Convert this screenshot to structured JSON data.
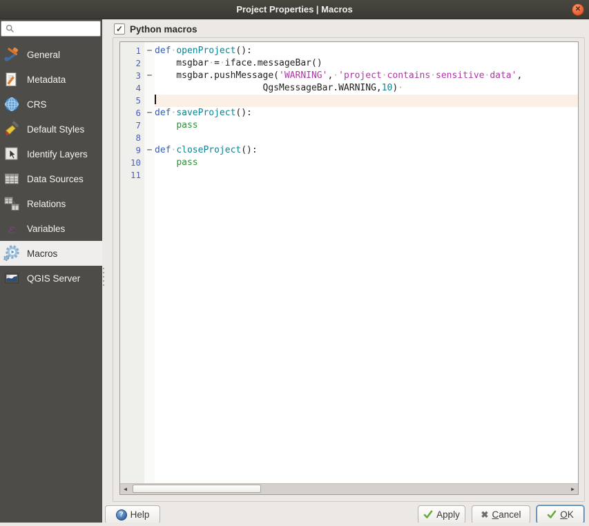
{
  "titlebar": {
    "title": "Project Properties | Macros",
    "close_icon": "✕"
  },
  "sidebar": {
    "search_placeholder": "",
    "items": [
      {
        "id": "general",
        "label": "General",
        "selected": false
      },
      {
        "id": "metadata",
        "label": "Metadata",
        "selected": false
      },
      {
        "id": "crs",
        "label": "CRS",
        "selected": false
      },
      {
        "id": "default-styles",
        "label": "Default Styles",
        "selected": false
      },
      {
        "id": "identify-layers",
        "label": "Identify Layers",
        "selected": false
      },
      {
        "id": "data-sources",
        "label": "Data Sources",
        "selected": false
      },
      {
        "id": "relations",
        "label": "Relations",
        "selected": false
      },
      {
        "id": "variables",
        "label": "Variables",
        "selected": false
      },
      {
        "id": "macros",
        "label": "Macros",
        "selected": true
      },
      {
        "id": "qgis-server",
        "label": "QGIS Server",
        "selected": false
      }
    ]
  },
  "main": {
    "python_macros_label": "Python macros",
    "checkbox_checked": true
  },
  "editor": {
    "lines": [
      {
        "num": "1",
        "fold": "−",
        "current": false,
        "cursor": false,
        "segments": [
          {
            "t": "kw",
            "x": "def"
          },
          {
            "t": "ws",
            "x": "·"
          },
          {
            "t": "fn",
            "x": "openProject"
          },
          {
            "t": "pln",
            "x": "():"
          }
        ]
      },
      {
        "num": "2",
        "fold": "",
        "current": false,
        "cursor": false,
        "segments": [
          {
            "t": "pln",
            "x": "    msgbar"
          },
          {
            "t": "ws",
            "x": "·"
          },
          {
            "t": "pln",
            "x": "="
          },
          {
            "t": "ws",
            "x": "·"
          },
          {
            "t": "pln",
            "x": "iface.messageBar()"
          }
        ]
      },
      {
        "num": "3",
        "fold": "−",
        "current": false,
        "cursor": false,
        "segments": [
          {
            "t": "pln",
            "x": "    msgbar.pushMessage("
          },
          {
            "t": "str",
            "x": "'WARNING'"
          },
          {
            "t": "pln",
            "x": ","
          },
          {
            "t": "ws",
            "x": "·"
          },
          {
            "t": "str",
            "x": "'project"
          },
          {
            "t": "ws",
            "x": "·"
          },
          {
            "t": "str",
            "x": "contains"
          },
          {
            "t": "ws",
            "x": "·"
          },
          {
            "t": "str",
            "x": "sensitive"
          },
          {
            "t": "ws",
            "x": "·"
          },
          {
            "t": "str",
            "x": "data'"
          },
          {
            "t": "pln",
            "x": ","
          }
        ]
      },
      {
        "num": "4",
        "fold": "",
        "current": false,
        "cursor": false,
        "segments": [
          {
            "t": "pln",
            "x": "                    QgsMessageBar.WARNING,"
          },
          {
            "t": "num",
            "x": "10"
          },
          {
            "t": "pln",
            "x": ")"
          },
          {
            "t": "ws",
            "x": "·"
          }
        ]
      },
      {
        "num": "5",
        "fold": "",
        "current": true,
        "cursor": true,
        "segments": []
      },
      {
        "num": "6",
        "fold": "−",
        "current": false,
        "cursor": false,
        "segments": [
          {
            "t": "kw",
            "x": "def"
          },
          {
            "t": "ws",
            "x": "·"
          },
          {
            "t": "fn",
            "x": "saveProject"
          },
          {
            "t": "pln",
            "x": "():"
          }
        ]
      },
      {
        "num": "7",
        "fold": "",
        "current": false,
        "cursor": false,
        "segments": [
          {
            "t": "pln",
            "x": "    "
          },
          {
            "t": "grn",
            "x": "pass"
          }
        ]
      },
      {
        "num": "8",
        "fold": "",
        "current": false,
        "cursor": false,
        "segments": []
      },
      {
        "num": "9",
        "fold": "−",
        "current": false,
        "cursor": false,
        "segments": [
          {
            "t": "kw",
            "x": "def"
          },
          {
            "t": "ws",
            "x": "·"
          },
          {
            "t": "fn",
            "x": "closeProject"
          },
          {
            "t": "pln",
            "x": "():"
          }
        ]
      },
      {
        "num": "10",
        "fold": "",
        "current": false,
        "cursor": false,
        "segments": [
          {
            "t": "pln",
            "x": "    "
          },
          {
            "t": "grn",
            "x": "pass"
          }
        ]
      },
      {
        "num": "11",
        "fold": "",
        "current": false,
        "cursor": false,
        "segments": []
      }
    ]
  },
  "icons": {
    "checkbox_check": "✓",
    "scroll_left": "◀",
    "scroll_right": "▶",
    "help_q": "?",
    "cancel_x": "✖"
  },
  "buttons": {
    "help": {
      "pre": "",
      "accel": "",
      "post": "Help"
    },
    "apply": {
      "pre": "",
      "accel": "",
      "post": "Apply"
    },
    "cancel": {
      "pre": "",
      "accel": "C",
      "post": "ancel"
    },
    "ok": {
      "pre": "",
      "accel": "O",
      "post": "K"
    }
  },
  "colors": {
    "titlebar_bg": "#403f3b",
    "close_button": "#e8643a",
    "sidebar_bg": "#4d4c48",
    "selected_item_bg": "#f0eeec",
    "current_line_bg": "#fbf0e6",
    "line_number": "#4c5fc0",
    "keyword": "#2d5bc4",
    "function_name": "#0e8390",
    "string": "#ab37a4",
    "number": "#0e8390",
    "pass_keyword": "#2e9331"
  }
}
